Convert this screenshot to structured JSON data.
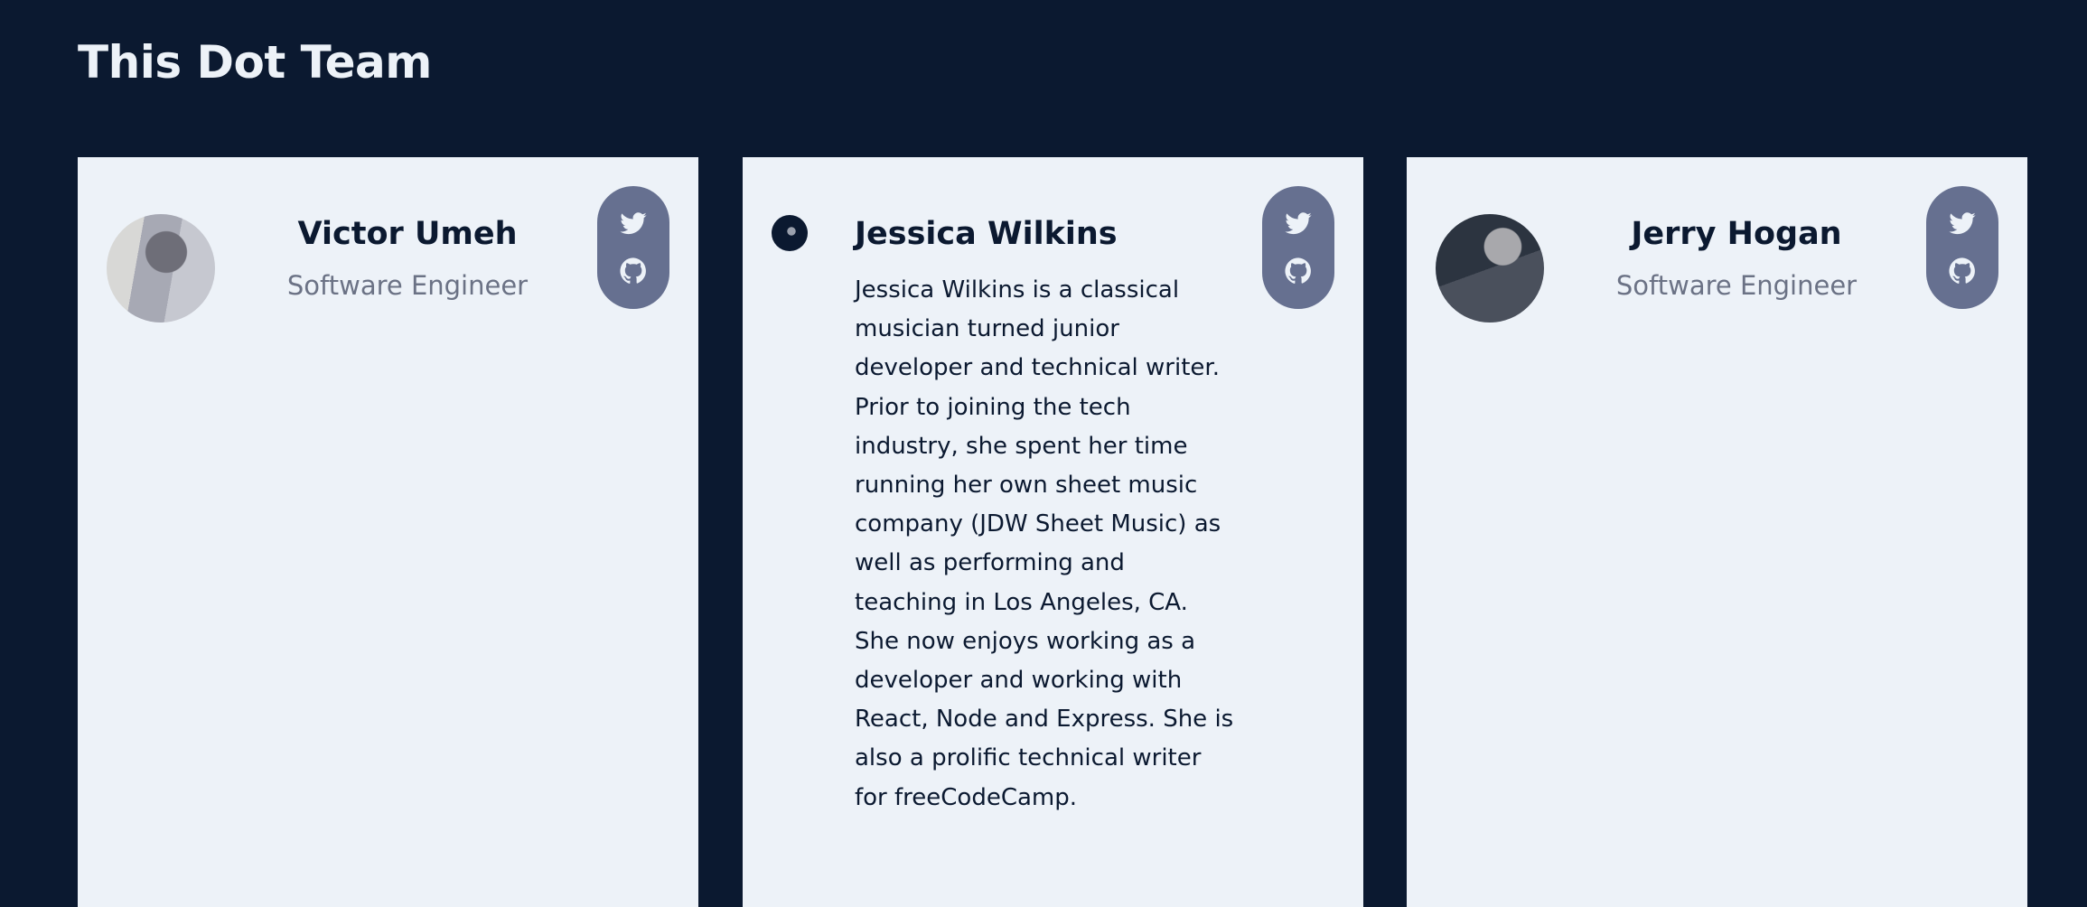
{
  "page": {
    "title": "This Dot Team"
  },
  "colors": {
    "background": "#0b1930",
    "card": "#edf2f8",
    "social_pill": "#667090",
    "name": "#0b1930",
    "role": "#6b7285"
  },
  "members": [
    {
      "name": "Victor Umeh",
      "role": "Software Engineer",
      "social": [
        "twitter-icon",
        "github-icon"
      ]
    },
    {
      "name": "Jessica Wilkins",
      "bio": "Jessica Wilkins is a classical musician turned junior developer and technical writer. Prior to joining the tech industry, she spent her time running her own sheet music company (JDW Sheet Music) as well as performing and teaching in Los Angeles, CA. She now enjoys working as a developer and working with React, Node and Express. She is also a prolific technical writer for freeCodeCamp.",
      "social": [
        "twitter-icon",
        "github-icon"
      ]
    },
    {
      "name": "Jerry Hogan",
      "role": "Software Engineer",
      "social": [
        "twitter-icon",
        "github-icon"
      ]
    }
  ]
}
